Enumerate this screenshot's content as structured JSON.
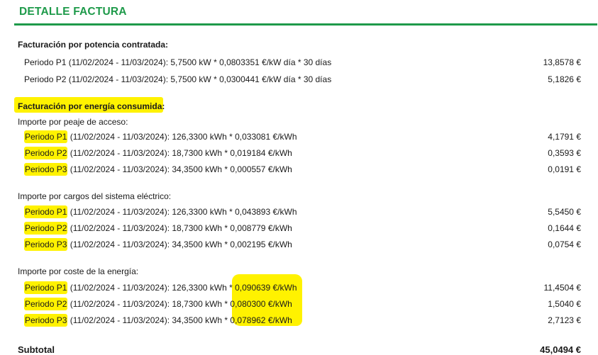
{
  "header": {
    "title": "DETALLE FACTURA",
    "accent_color": "#1e9a4a",
    "highlight_color": "#fff200"
  },
  "potencia": {
    "title": "Facturación por potencia contratada:",
    "rows": [
      {
        "periodo": "Periodo P1",
        "detalle": "(11/02/2024 - 11/03/2024): 5,7500 kW * 0,0803351 €/kW día * 30 días",
        "importe": "13,8578 €"
      },
      {
        "periodo": "Periodo P2",
        "detalle": "(11/02/2024 - 11/03/2024): 5,7500 kW * 0,0300441 €/kW día * 30 días",
        "importe": "5,1826 €"
      }
    ]
  },
  "energia": {
    "title": "Facturación por energía consumida:",
    "groups": [
      {
        "title": "Importe por peaje de acceso:",
        "rows": [
          {
            "periodo": "Periodo P1",
            "detalle": "(11/02/2024 - 11/03/2024): 126,3300 kWh * 0,033081 €/kWh",
            "importe": "4,1791 €"
          },
          {
            "periodo": "Periodo P2",
            "detalle": "(11/02/2024 - 11/03/2024): 18,7300 kWh * 0,019184 €/kWh",
            "importe": "0,3593 €"
          },
          {
            "periodo": "Periodo P3",
            "detalle": "(11/02/2024 - 11/03/2024): 34,3500 kWh * 0,000557 €/kWh",
            "importe": "0,0191 €"
          }
        ]
      },
      {
        "title": "Importe por cargos del sistema eléctrico:",
        "rows": [
          {
            "periodo": "Periodo P1",
            "detalle": "(11/02/2024 - 11/03/2024): 126,3300 kWh * 0,043893 €/kWh",
            "importe": "5,5450 €"
          },
          {
            "periodo": "Periodo P2",
            "detalle": "(11/02/2024 - 11/03/2024): 18,7300 kWh * 0,008779 €/kWh",
            "importe": "0,1644 €"
          },
          {
            "periodo": "Periodo P3",
            "detalle": "(11/02/2024 - 11/03/2024): 34,3500 kWh * 0,002195 €/kWh",
            "importe": "0,0754 €"
          }
        ]
      },
      {
        "title": "Importe por coste de la energía:",
        "rows": [
          {
            "periodo": "Periodo P1",
            "detalle": "(11/02/2024 - 11/03/2024): 126,3300 kWh * 0,090639 €/kWh",
            "importe": "11,4504 €"
          },
          {
            "periodo": "Periodo P2",
            "detalle": "(11/02/2024 - 11/03/2024): 18,7300 kWh * 0,080300 €/kWh",
            "importe": "1,5040 €"
          },
          {
            "periodo": "Periodo P3",
            "detalle": "(11/02/2024 - 11/03/2024): 34,3500 kWh * 0,078962 €/kWh",
            "importe": "2,7123 €"
          }
        ]
      }
    ]
  },
  "subtotal": {
    "label": "Subtotal",
    "importe": "45,0494 €"
  }
}
